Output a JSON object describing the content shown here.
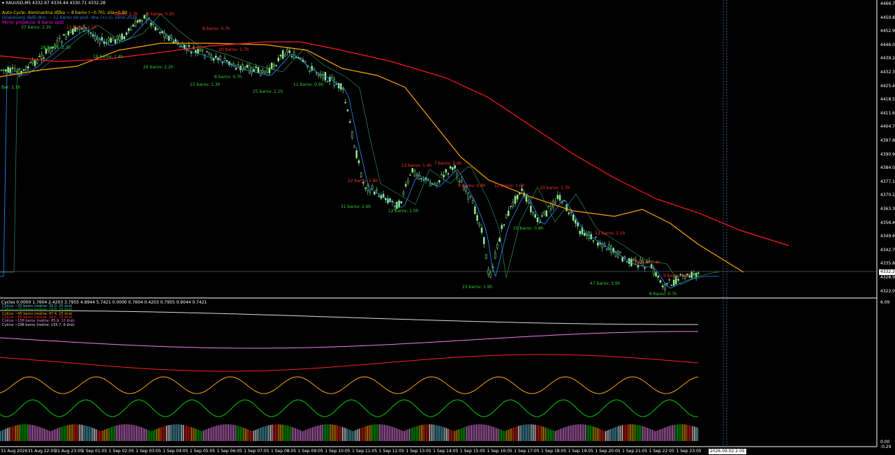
{
  "header": {
    "symbol_line": "XAUUSD,M5  4332.67 4334.44 4330.71 4332.28",
    "info_lines": [
      {
        "text": "Auto-Cycle: dominantna dĺžka ~ 8 barov (~0.7h), sila=0.90",
        "color": "#ffd700"
      },
      {
        "text": "Očakávaný ďalší dno: ~ 12 barov od posl. dna (+/-1), okno 2026",
        "color": "#3a7bd5"
      },
      {
        "text": "Mirror projekcia: 8 barov späť",
        "color": "#ff00ff"
      }
    ]
  },
  "price_axis": {
    "labels": [
      "4466.70",
      "4459.80",
      "4452.90",
      "4446.00",
      "4439.20",
      "4432.30",
      "4425.40",
      "4418.50",
      "4411.60",
      "4404.70",
      "4397.80",
      "4390.90",
      "4384.00",
      "4377.10",
      "4370.20",
      "4363.30",
      "4356.40",
      "4349.60",
      "4342.70",
      "4335.80",
      "4328.90",
      "4322.00"
    ],
    "current_price": "4332.28",
    "current_price_color": "#ffffff"
  },
  "indicator_axis": {
    "top": "6.09",
    "bottom": "0.00",
    "lowest": "-0.29"
  },
  "time_axis": {
    "labels": [
      "31 Aug 2026",
      "31 Aug 22:05",
      "31 Aug 23:05",
      "1 Sep 01:05",
      "1 Sep 02:05",
      "1 Sep 03:05",
      "1 Sep 04:05",
      "1 Sep 05:05",
      "1 Sep 06:05",
      "1 Sep 07:05",
      "1 Sep 08:05",
      "1 Sep 09:05",
      "1 Sep 10:05",
      "1 Sep 11:05",
      "1 Sep 12:05",
      "1 Sep 13:05",
      "1 Sep 14:05",
      "1 Sep 15:05",
      "1 Sep 16:05",
      "1 Sep 17:05",
      "1 Sep 18:05",
      "1 Sep 19:05",
      "1 Sep 20:05",
      "1 Sep 21:05",
      "1 Sep 22:05",
      "1 Sep 23:05"
    ],
    "highlight": "2026.09.02 2:05"
  },
  "cycles_panel": {
    "title": "Cycles 0.0000 1.7604 2.4203 3.7955 4.8944 5.7421 0.0000 0.7604 0.4203 0.7955 0.9044 0.7421",
    "legend": [
      {
        "text": "Cyklus ~30 barov (reálne: 30.0, 25 dná)",
        "color": "#5bc0de"
      },
      {
        "text": "Cyklus ~20 barov (reálne: 19.8, 25 dná)",
        "color": "#00cc00"
      },
      {
        "text": "Cyklus ~45 barov (reálne: 47.4, 25 dná)",
        "color": "#ffa500"
      },
      {
        "text": "Cyklus ~86 barov (reálne: 31.6, 25 dná)",
        "color": "#ff2020"
      },
      {
        "text": "Cyklus ~158 barov (reálne: 85.9, 13 dná)",
        "color": "#ee82ee"
      },
      {
        "text": "Cyklus ~298 barov (reálne: 155.7, 8 dná)",
        "color": "#dddddd"
      }
    ]
  },
  "annotations": {
    "green": [
      "Bar: 1.1h",
      "28 barov: 2.3h",
      "18 barov: 1.4h",
      "26 barov: 2.2h",
      "15 barov: 1.3h",
      "8 barov: 0.7h",
      "25 barov: 2.1h",
      "11 barov: 0.9h",
      "31 barov: 2.6h",
      "12 barov: 1.0h",
      "23 barov: 1.9h",
      "10 barov: 0.8h",
      "47 barov: 3.9h",
      "8 barov: 0.7h",
      "37 barov: 2.3h"
    ],
    "red": [
      "barov: 2.3h",
      "8 barov: 0.5h",
      "13 barov: 1.1h",
      "8 barov: 0.7h",
      "20 barov: 1.7h",
      "22 barov: 1.8h",
      "13 barov: 1.4h",
      "7 barov: 0.6h",
      "9 barov: 0.8h",
      "12 barov: 1.0h",
      "20 barov: 1.7h",
      "5 barov: 0.4h",
      "13 barov: 1.1h",
      "9 barov: 0.9h"
    ]
  },
  "colors": {
    "bg": "#000000",
    "candle": "#90ee90",
    "ma_red": "#ff1a1a",
    "ma_orange": "#ffa500",
    "ma_blue": "#1e90ff",
    "ma_green": "#2e8b57"
  }
}
